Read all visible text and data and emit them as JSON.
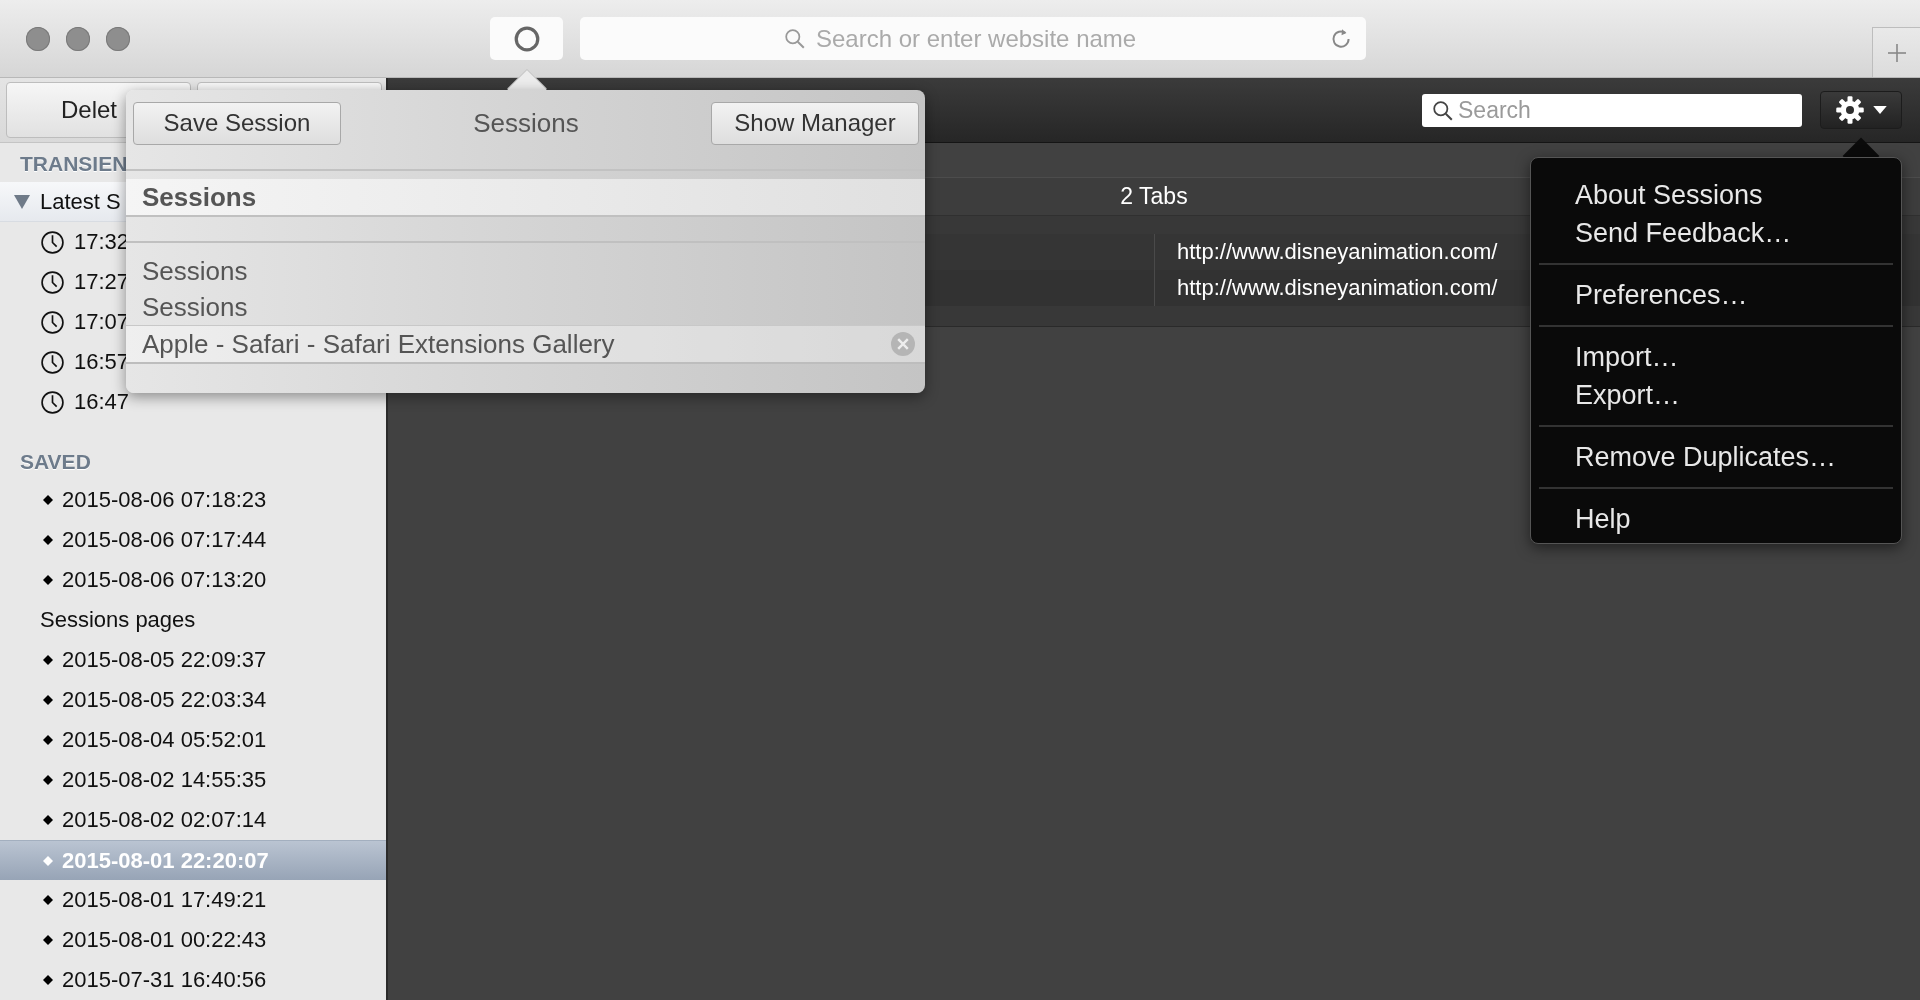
{
  "address_bar": {
    "placeholder": "Search or enter website name"
  },
  "sidebar": {
    "delete_button": "Delet",
    "sections": [
      {
        "title": "TRANSIEN",
        "items": [
          {
            "kind": "group",
            "label": "Latest S",
            "expanded": true,
            "selected": false,
            "children": [
              {
                "kind": "time",
                "label": "17:32",
                "selected": false
              },
              {
                "kind": "time",
                "label": "17:27",
                "selected": false
              },
              {
                "kind": "time",
                "label": "17:07",
                "selected": false
              },
              {
                "kind": "time",
                "label": "16:57",
                "selected": false
              },
              {
                "kind": "time",
                "label": "16:47",
                "selected": false
              }
            ]
          }
        ]
      },
      {
        "title": "SAVED",
        "items": [
          {
            "kind": "session",
            "label": "2015-08-06 07:18:23",
            "selected": false
          },
          {
            "kind": "session",
            "label": "2015-08-06 07:17:44",
            "selected": false
          },
          {
            "kind": "session",
            "label": "2015-08-06 07:13:20",
            "selected": false
          },
          {
            "kind": "folder",
            "label": "Sessions pages",
            "selected": false
          },
          {
            "kind": "session",
            "label": "2015-08-05 22:09:37",
            "selected": false
          },
          {
            "kind": "session",
            "label": "2015-08-05 22:03:34",
            "selected": false
          },
          {
            "kind": "session",
            "label": "2015-08-04 05:52:01",
            "selected": false
          },
          {
            "kind": "session",
            "label": "2015-08-02 14:55:35",
            "selected": false
          },
          {
            "kind": "session",
            "label": "2015-08-02 02:07:14",
            "selected": false
          },
          {
            "kind": "session",
            "label": "2015-08-01 22:20:07",
            "selected": true
          },
          {
            "kind": "session",
            "label": "2015-08-01 17:49:21",
            "selected": false
          },
          {
            "kind": "session",
            "label": "2015-08-01 00:22:43",
            "selected": false
          },
          {
            "kind": "session",
            "label": "2015-07-31 16:40:56",
            "selected": false
          }
        ]
      }
    ]
  },
  "content": {
    "search": {
      "placeholder": "Search"
    },
    "table": {
      "header": "2 Tabs",
      "rows": [
        {
          "url": "http://www.disneyanimation.com/"
        },
        {
          "url": "http://www.disneyanimation.com/"
        }
      ]
    }
  },
  "popover": {
    "save_button": "Save Session",
    "title": "Sessions",
    "manager_button": "Show Manager",
    "rows": [
      {
        "kind": "heading",
        "label": "Sessions"
      },
      {
        "kind": "spacer"
      },
      {
        "kind": "item",
        "label": "Sessions",
        "removable": false
      },
      {
        "kind": "item",
        "label": "Sessions",
        "removable": false
      },
      {
        "kind": "item",
        "label": "Apple - Safari - Safari Extensions Gallery",
        "removable": true
      }
    ]
  },
  "menu": {
    "groups": [
      {
        "items": [
          "About Sessions",
          "Send Feedback…"
        ]
      },
      {
        "items": [
          "Preferences…"
        ]
      },
      {
        "items": [
          "Import…",
          "Export…"
        ]
      },
      {
        "items": [
          "Remove Duplicates…"
        ]
      },
      {
        "items": [
          "Help"
        ]
      }
    ]
  }
}
